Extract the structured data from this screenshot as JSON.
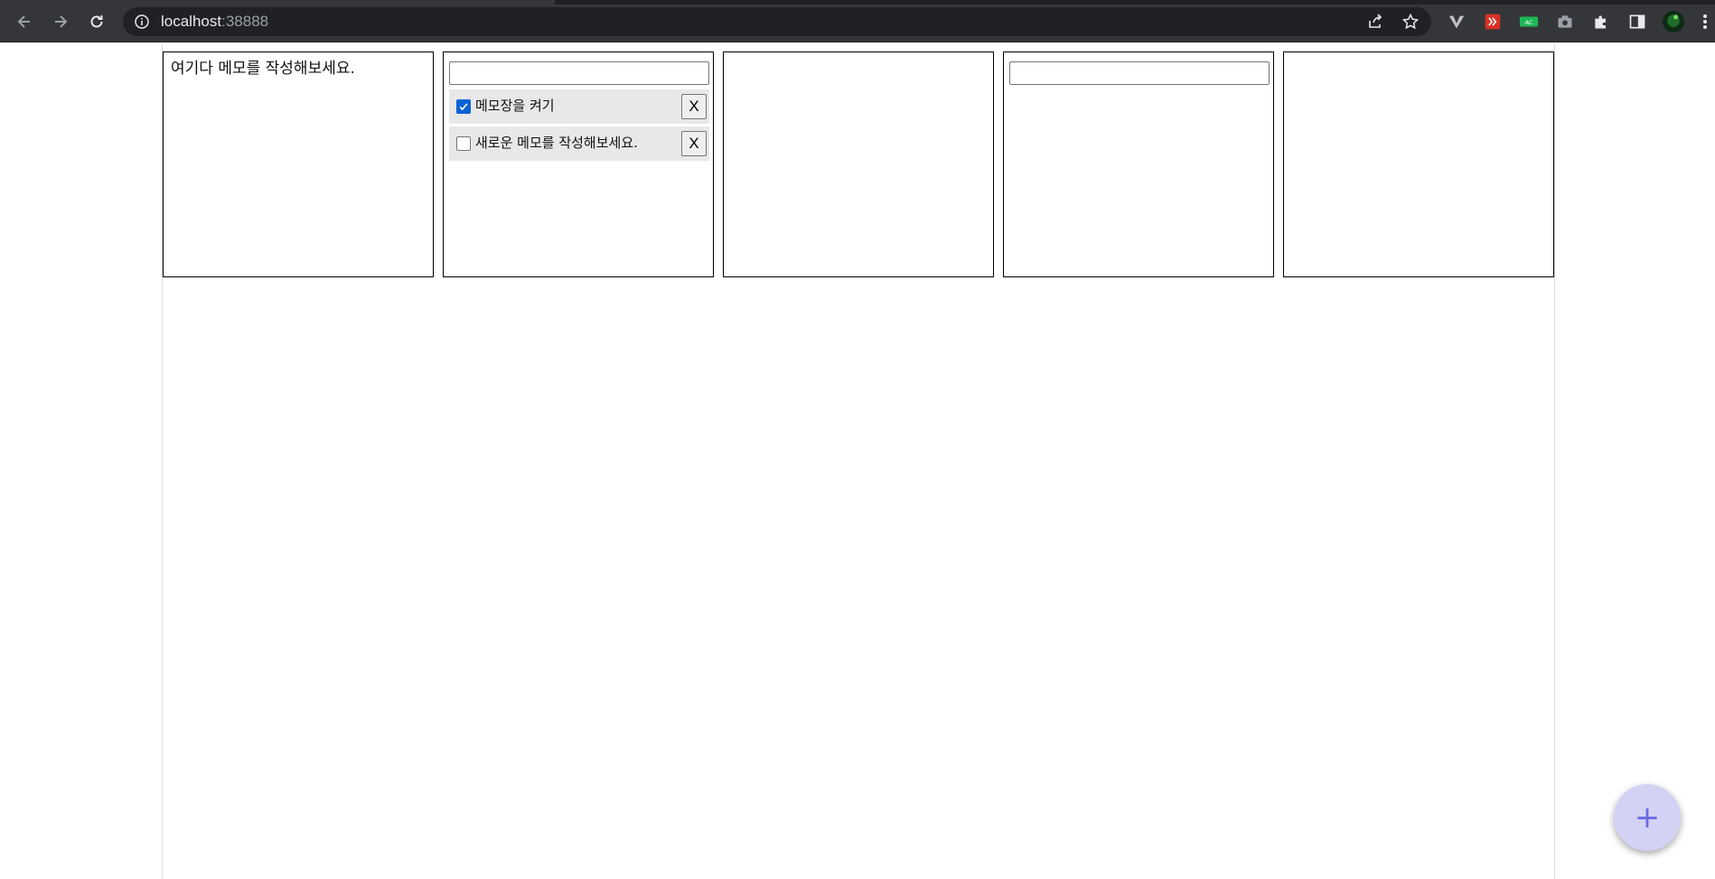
{
  "browser": {
    "url_host": "localhost",
    "url_port": ":38888"
  },
  "memo_card": {
    "text": "여기다 메모를 작성해보세요."
  },
  "todo_card": {
    "input_value": "",
    "items": [
      {
        "label": "메모장을 켜기",
        "checked": true,
        "delete_label": "X"
      },
      {
        "label": "새로운 메모를 작성해보세요.",
        "checked": false,
        "delete_label": "X"
      }
    ]
  },
  "todo_card_2": {
    "input_value": ""
  },
  "fab": {
    "label": "+"
  },
  "colors": {
    "chrome_bg": "#35363a",
    "omnibox_bg": "#202124",
    "fab_bg": "#d3d2f5",
    "fab_icon": "#6b6ae0",
    "checkbox_checked": "#0b62d6"
  }
}
